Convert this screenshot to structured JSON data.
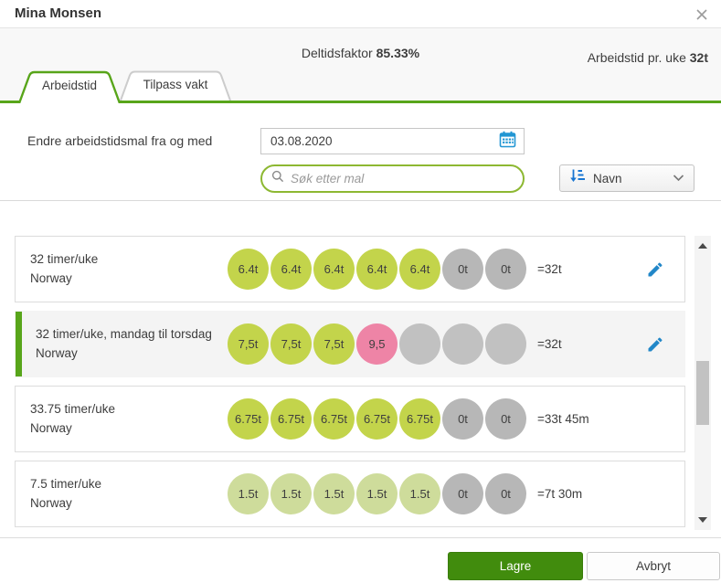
{
  "modal": {
    "title": "Mina Monsen"
  },
  "summary": {
    "deltidsfaktor_label": "Deltidsfaktor",
    "deltidsfaktor_value": "85.33%",
    "arbeidstid_label": "Arbeidstid pr. uke",
    "arbeidstid_value": "32t"
  },
  "tabs": [
    {
      "label": "Arbeidstid",
      "active": true
    },
    {
      "label": "Tilpass vakt",
      "active": false
    }
  ],
  "form": {
    "date_label": "Endre arbeidstidsmal fra og med",
    "date_value": "03.08.2020",
    "search_placeholder": "Søk etter mal",
    "sort_label": "Navn"
  },
  "colors": {
    "accent_green": "#58a51a",
    "save_green": "#418c0d",
    "circle_green": "#c3d44b",
    "circle_pale_green": "#cedc9b",
    "circle_pink": "#ee84a6",
    "circle_gray": "#b7b7b7",
    "circle_empty_gray": "#c1c1c1",
    "icon_blue": "#2196d3"
  },
  "templates": [
    {
      "name": "32 timer/uke",
      "unit": "Norway",
      "total": "=32t",
      "selected": false,
      "editable": true,
      "days": [
        {
          "label": "6.4t",
          "bg": "#c3d44b"
        },
        {
          "label": "6.4t",
          "bg": "#c3d44b"
        },
        {
          "label": "6.4t",
          "bg": "#c3d44b"
        },
        {
          "label": "6.4t",
          "bg": "#c3d44b"
        },
        {
          "label": "6.4t",
          "bg": "#c3d44b"
        },
        {
          "label": "0t",
          "bg": "#b7b7b7"
        },
        {
          "label": "0t",
          "bg": "#b7b7b7"
        }
      ]
    },
    {
      "name": "32 timer/uke, mandag til torsdag",
      "unit": "Norway",
      "total": "=32t",
      "selected": true,
      "editable": true,
      "days": [
        {
          "label": "7,5t",
          "bg": "#c3d44b"
        },
        {
          "label": "7,5t",
          "bg": "#c3d44b"
        },
        {
          "label": "7,5t",
          "bg": "#c3d44b"
        },
        {
          "label": "9,5",
          "bg": "#ee84a6"
        },
        {
          "label": "",
          "bg": "#c1c1c1"
        },
        {
          "label": "",
          "bg": "#c1c1c1"
        },
        {
          "label": "",
          "bg": "#c1c1c1"
        }
      ]
    },
    {
      "name": "33.75 timer/uke",
      "unit": "Norway",
      "total": "=33t 45m",
      "selected": false,
      "editable": false,
      "days": [
        {
          "label": "6.75t",
          "bg": "#c3d44b"
        },
        {
          "label": "6.75t",
          "bg": "#c3d44b"
        },
        {
          "label": "6.75t",
          "bg": "#c3d44b"
        },
        {
          "label": "6.75t",
          "bg": "#c3d44b"
        },
        {
          "label": "6.75t",
          "bg": "#c3d44b"
        },
        {
          "label": "0t",
          "bg": "#b7b7b7"
        },
        {
          "label": "0t",
          "bg": "#b7b7b7"
        }
      ]
    },
    {
      "name": "7.5 timer/uke",
      "unit": "Norway",
      "total": "=7t 30m",
      "selected": false,
      "editable": false,
      "days": [
        {
          "label": "1.5t",
          "bg": "#cedc9b"
        },
        {
          "label": "1.5t",
          "bg": "#cedc9b"
        },
        {
          "label": "1.5t",
          "bg": "#cedc9b"
        },
        {
          "label": "1.5t",
          "bg": "#cedc9b"
        },
        {
          "label": "1.5t",
          "bg": "#cedc9b"
        },
        {
          "label": "0t",
          "bg": "#b7b7b7"
        },
        {
          "label": "0t",
          "bg": "#b7b7b7"
        }
      ]
    }
  ],
  "footer": {
    "save_label": "Lagre",
    "cancel_label": "Avbryt"
  }
}
